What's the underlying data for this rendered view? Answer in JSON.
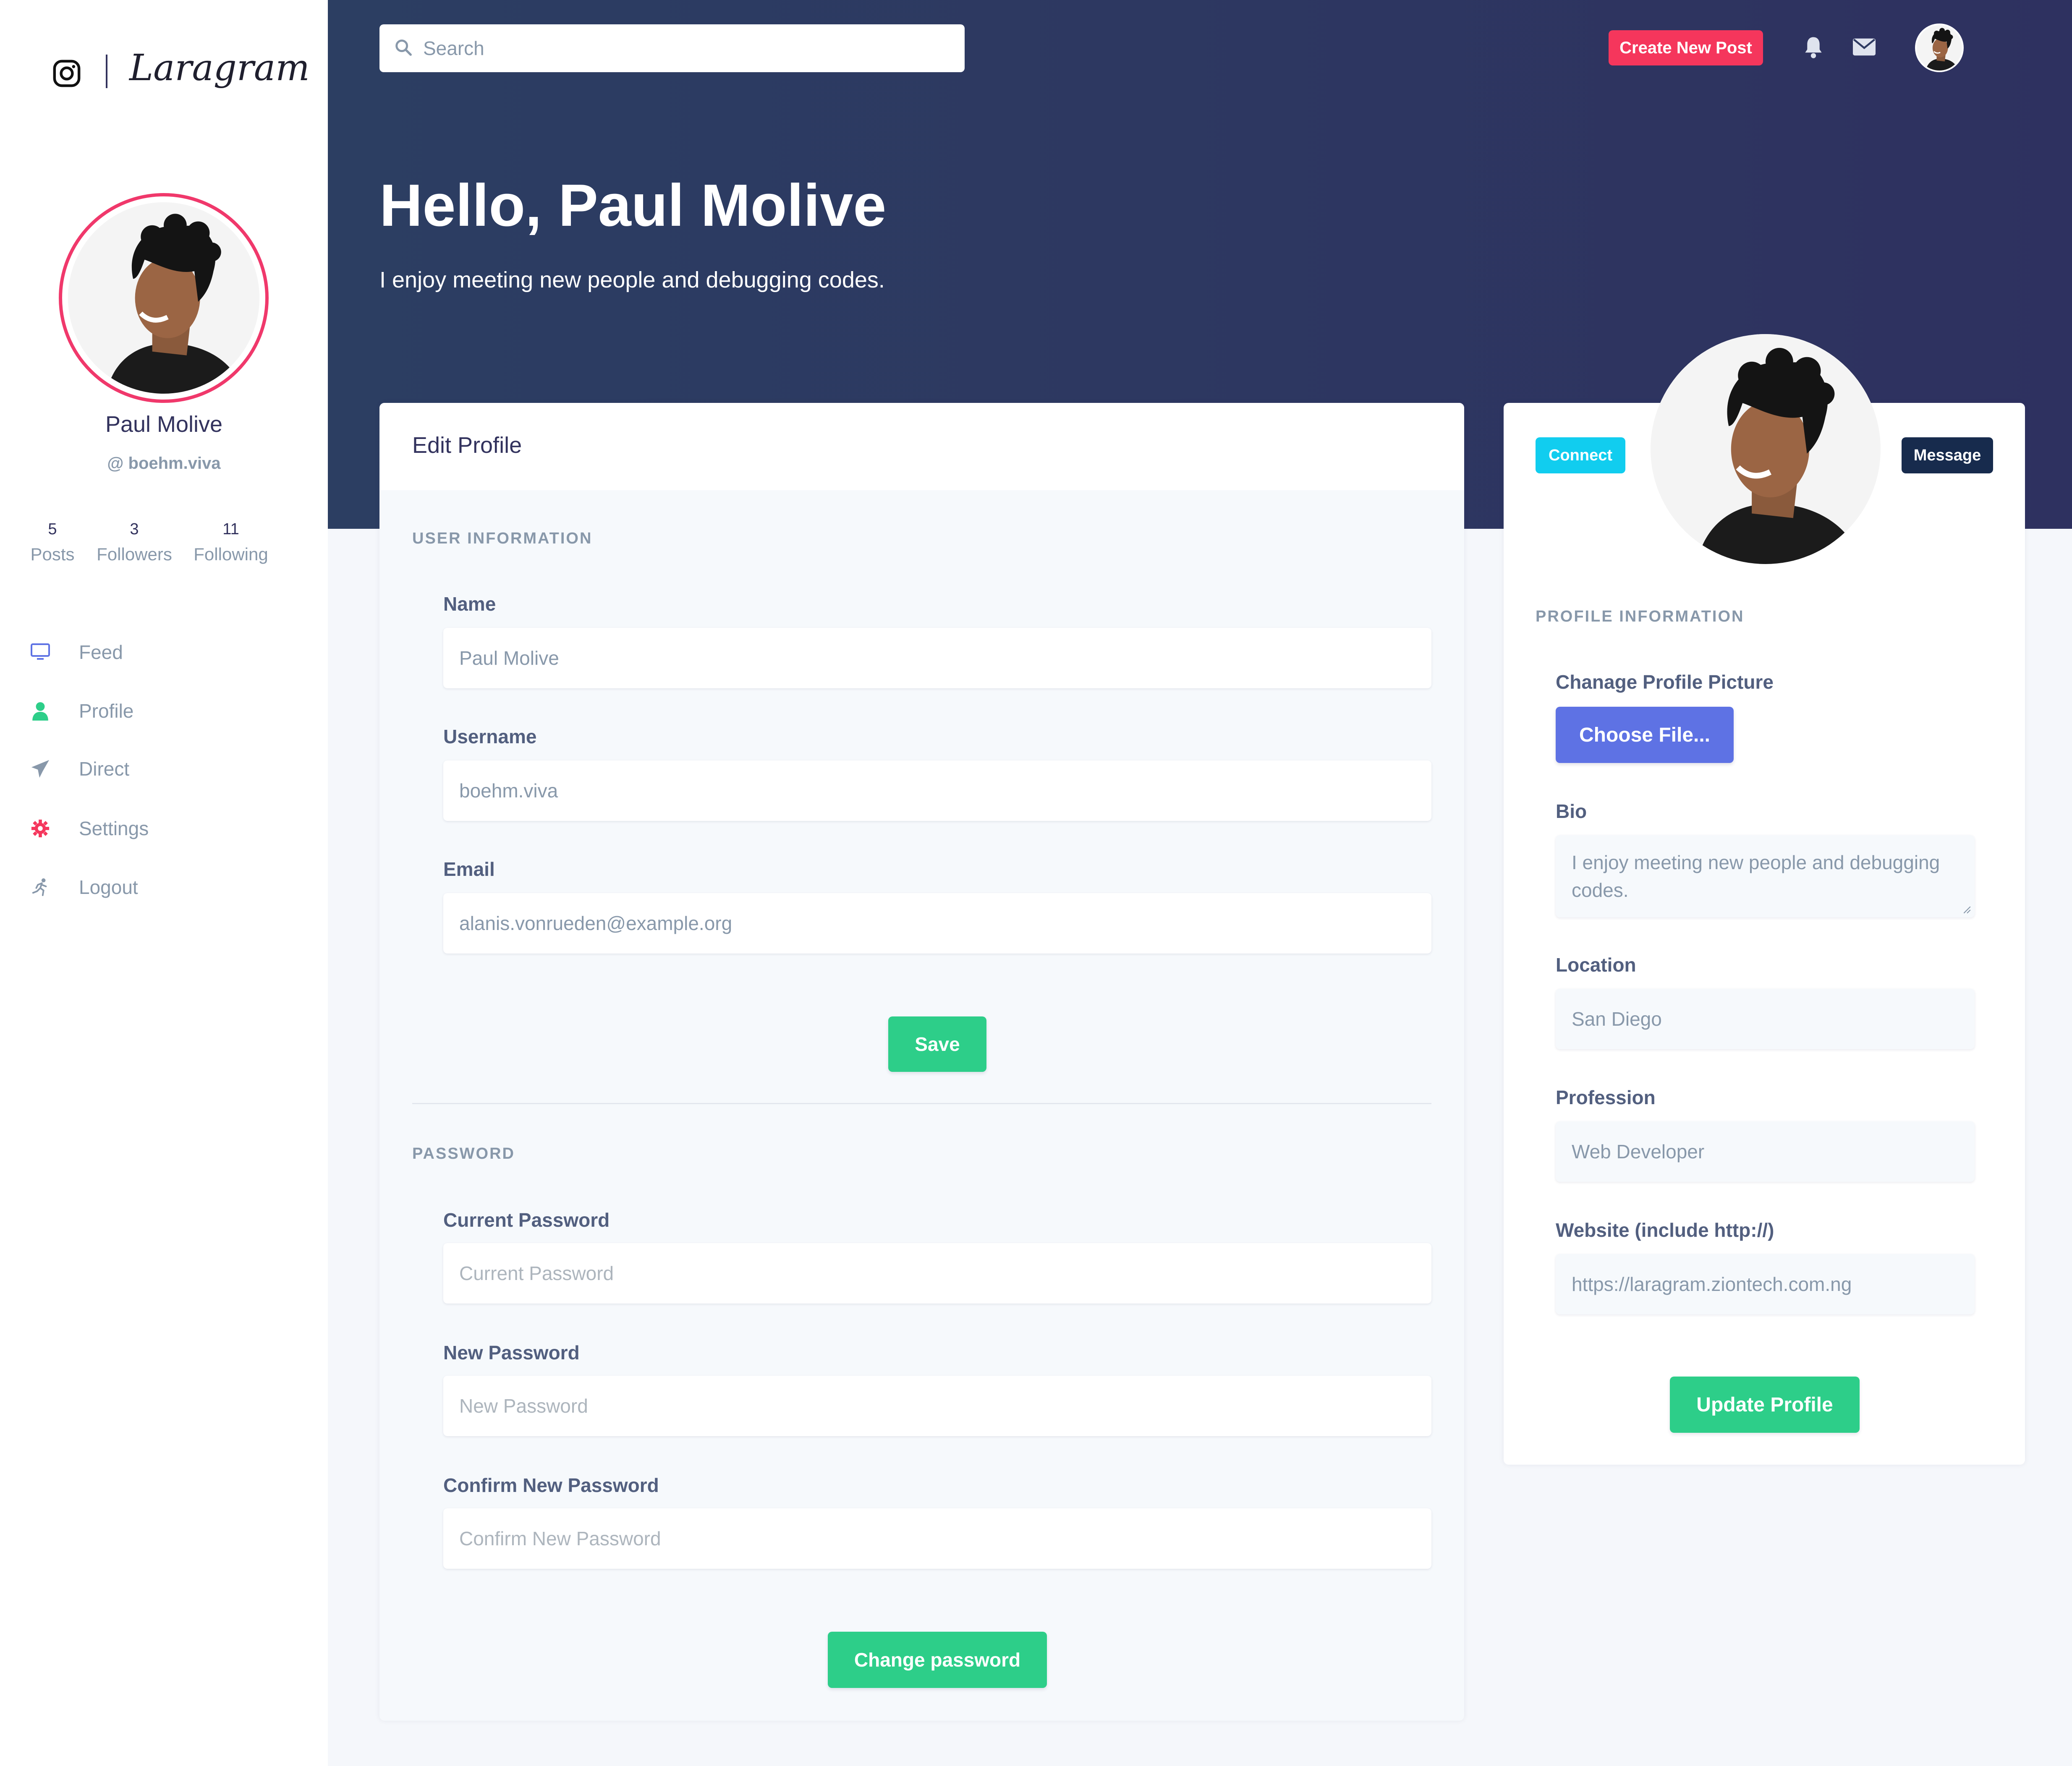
{
  "brand": {
    "name": "Laragram",
    "icon": "instagram-icon"
  },
  "sidebar": {
    "name": "Paul Molive",
    "handle": "@ boehm.viva",
    "stats": [
      {
        "value": "5",
        "label": "Posts"
      },
      {
        "value": "3",
        "label": "Followers"
      },
      {
        "value": "11",
        "label": "Following"
      }
    ],
    "nav": [
      {
        "label": "Feed",
        "icon": "monitor-icon",
        "color": "#5e72e4"
      },
      {
        "label": "Profile",
        "icon": "user-icon",
        "color": "#2dce89"
      },
      {
        "label": "Direct",
        "icon": "paper-plane-icon",
        "color": "#8898aa"
      },
      {
        "label": "Settings",
        "icon": "gear-icon",
        "color": "#f5365c"
      },
      {
        "label": "Logout",
        "icon": "running-icon",
        "color": "#8898aa"
      }
    ]
  },
  "topbar": {
    "search_placeholder": "Search",
    "create_label": "Create New Post",
    "icons": [
      "bell-icon",
      "envelope-icon",
      "avatar"
    ]
  },
  "hero": {
    "greeting": "Hello, Paul Molive",
    "tagline": "I enjoy meeting new people and debugging codes."
  },
  "edit_profile": {
    "title": "Edit Profile",
    "user_section": "USER INFORMATION",
    "name_label": "Name",
    "name_value": "Paul Molive",
    "username_label": "Username",
    "username_value": "boehm.viva",
    "email_label": "Email",
    "email_value": "alanis.vonrueden@example.org",
    "save_label": "Save",
    "password_section": "PASSWORD",
    "current_label": "Current Password",
    "current_placeholder": "Current Password",
    "new_label": "New Password",
    "new_placeholder": "New Password",
    "confirm_label": "Confirm New Password",
    "confirm_placeholder": "Confirm New Password",
    "change_label": "Change password"
  },
  "profile_card": {
    "connect_label": "Connect",
    "message_label": "Message",
    "section": "PROFILE INFORMATION",
    "picture_label": "Chanage Profile Picture",
    "choose_label": "Choose File...",
    "bio_label": "Bio",
    "bio_value": "I enjoy meeting new people and debugging codes.",
    "location_label": "Location",
    "location_value": "San Diego",
    "profession_label": "Profession",
    "profession_value": "Web Developer",
    "website_label": "Website (include http://)",
    "website_value": "https://laragram.ziontech.com.ng",
    "update_label": "Update Profile"
  },
  "colors": {
    "accent_pink": "#f5365c",
    "success": "#2dce89",
    "primary": "#5e72e4",
    "info": "#11cdef",
    "dark": "#172b4d",
    "hero_bg": "#2c3e62"
  }
}
